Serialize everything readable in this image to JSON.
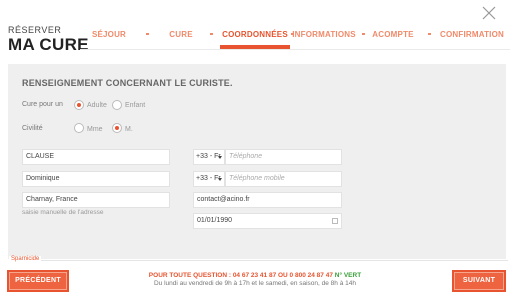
{
  "header": {
    "kicker": "RÉSERVER",
    "title": "MA CURE"
  },
  "steps": [
    {
      "label": "SÉJOUR",
      "active": false
    },
    {
      "label": "CURE",
      "active": false
    },
    {
      "label": "COORDONNÉES",
      "active": true
    },
    {
      "label": "INFORMATIONS",
      "active": false
    },
    {
      "label": "ACOMPTE",
      "active": false
    },
    {
      "label": "CONFIRMATION",
      "active": false
    }
  ],
  "form": {
    "section_title": "RENSEIGNEMENT CONCERNANT LE CURISTE.",
    "cure_pour_label": "Cure pour un",
    "cure_options": [
      "Adulte",
      "Enfant"
    ],
    "cure_selected": "Adulte",
    "civilite_label": "Civilité",
    "civilite_options": [
      "Mme",
      "M."
    ],
    "civilite_selected": "M.",
    "last_name": "CLAUSE",
    "first_name": "Dominique",
    "city": "Charnay, France",
    "address_hint": "saisie manuelle de l'adresse",
    "phone_prefix": "+33 - Fr",
    "phone_placeholder": "Téléphone",
    "mobile_prefix": "+33 - Fr",
    "mobile_placeholder": "Téléphone mobile",
    "email": "contact@acino.fr",
    "birthdate": "01/01/1990"
  },
  "footer": {
    "sponsor_label": "Sparnicide",
    "prev_label": "PRÉCÉDENT",
    "next_label": "SUIVANT",
    "contact_prefix": "POUR TOUTE QUESTION : 04 67 23 41 87 OU 0 800 24 87 47 ",
    "contact_green": "N° VERT",
    "contact_hours": "Du lundi au vendredi de 9h à 17h et le samedi, en saison, de 8h à 14h"
  },
  "colors": {
    "accent": "#e7542f",
    "accent_light": "#f08a6a",
    "panel": "#efefef",
    "green": "#3aa03a"
  }
}
